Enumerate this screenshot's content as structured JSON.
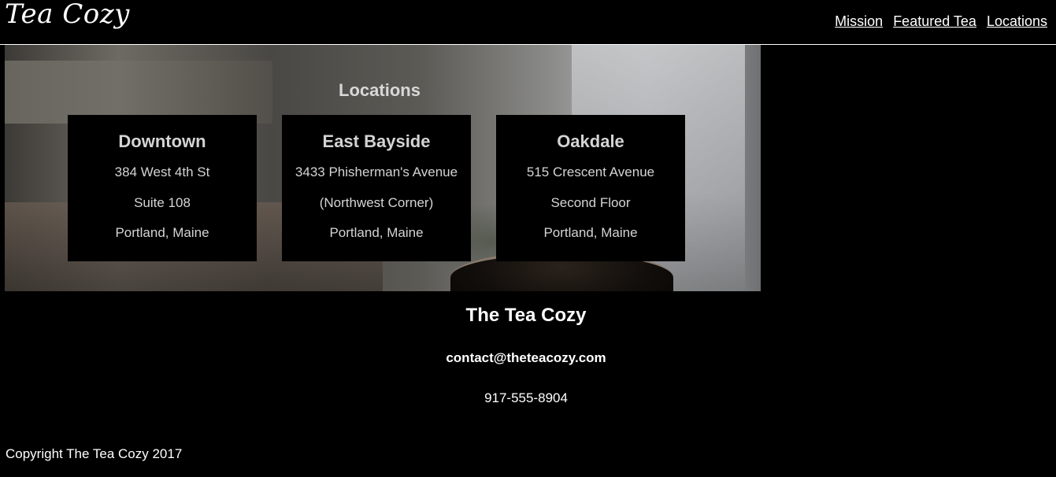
{
  "brand": {
    "logo": "Tea Cozy"
  },
  "nav": {
    "items": [
      "Mission",
      "Featured Tea",
      "Locations"
    ]
  },
  "locations": {
    "heading": "Locations",
    "cards": [
      {
        "name": "Downtown",
        "lines": [
          "384 West 4th St",
          "Suite 108",
          "Portland, Maine"
        ]
      },
      {
        "name": "East Bayside",
        "lines": [
          "3433 Phisherman's Avenue",
          "(Northwest Corner)",
          "Portland, Maine"
        ]
      },
      {
        "name": "Oakdale",
        "lines": [
          "515 Crescent Avenue",
          "Second Floor",
          "Portland, Maine"
        ]
      }
    ]
  },
  "contact": {
    "name": "The Tea Cozy",
    "email": "contact@theteacozy.com",
    "phone": "917-555-8904"
  },
  "footer": {
    "copyright": "Copyright The Tea Cozy 2017"
  },
  "colors": {
    "background": "#000000",
    "text": "#ffffff",
    "card_text": "#d4d4d4"
  }
}
